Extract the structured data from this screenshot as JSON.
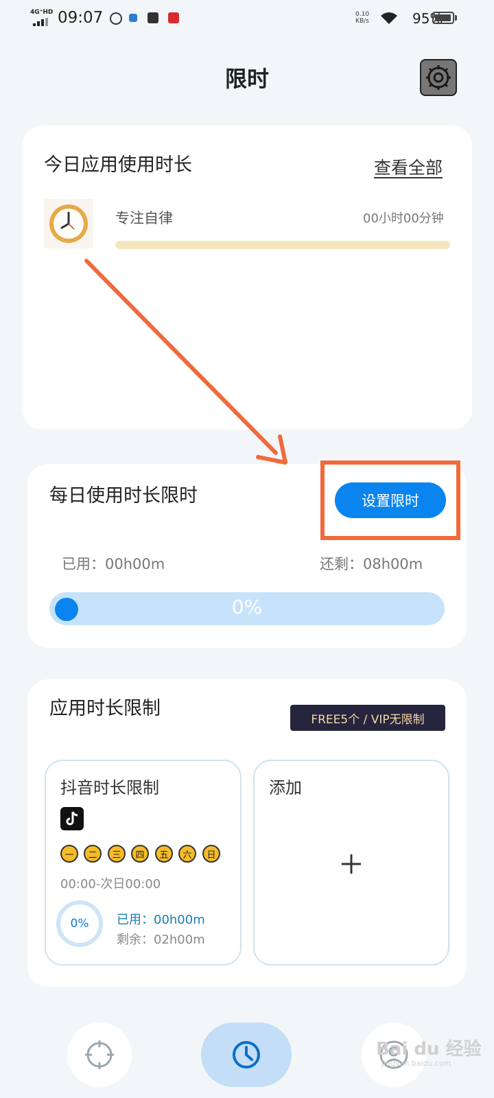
{
  "status_bar": {
    "network": "4G⁺HD",
    "time": "09:07",
    "speed_value": "0.10",
    "speed_unit": "KB/s",
    "battery_percent": "95%",
    "battery_level": 0.95
  },
  "header": {
    "title": "限时"
  },
  "today_usage": {
    "title": "今日应用使用时长",
    "view_all": "查看全部",
    "app_name": "专注自律",
    "app_time": "00小时00分钟"
  },
  "daily_limit": {
    "title": "每日使用时长限时",
    "set_button": "设置限时",
    "used": "已用：00h00m",
    "remaining": "还剩：08h00m",
    "percent_text": "0%",
    "progress": 0
  },
  "app_limits": {
    "title": "应用时长限制",
    "badge": "FREE5个 / VIP无限制",
    "limit_card": {
      "title": "抖音时长限制",
      "days": [
        "一",
        "二",
        "三",
        "四",
        "五",
        "六",
        "日"
      ],
      "schedule": "00:00-次日00:00",
      "percent": "0%",
      "used": "已用：00h00m",
      "remaining": "剩余：02h00m"
    },
    "add_card": {
      "title": "添加"
    }
  },
  "watermark": {
    "text": "Bai du 经验",
    "sub": "jingyan.baidu.com"
  },
  "colors": {
    "accent": "#0a85f0",
    "annotation": "#f06a3c",
    "usage_bar": "#f4e6bd"
  },
  "icons": {
    "settings": "gear-icon",
    "app": "clock-icon",
    "tiktok": "tiktok-icon",
    "add": "plus-icon",
    "nav_focus": "crosshair-icon",
    "nav_limit": "clock-icon",
    "nav_profile": "user-icon"
  }
}
